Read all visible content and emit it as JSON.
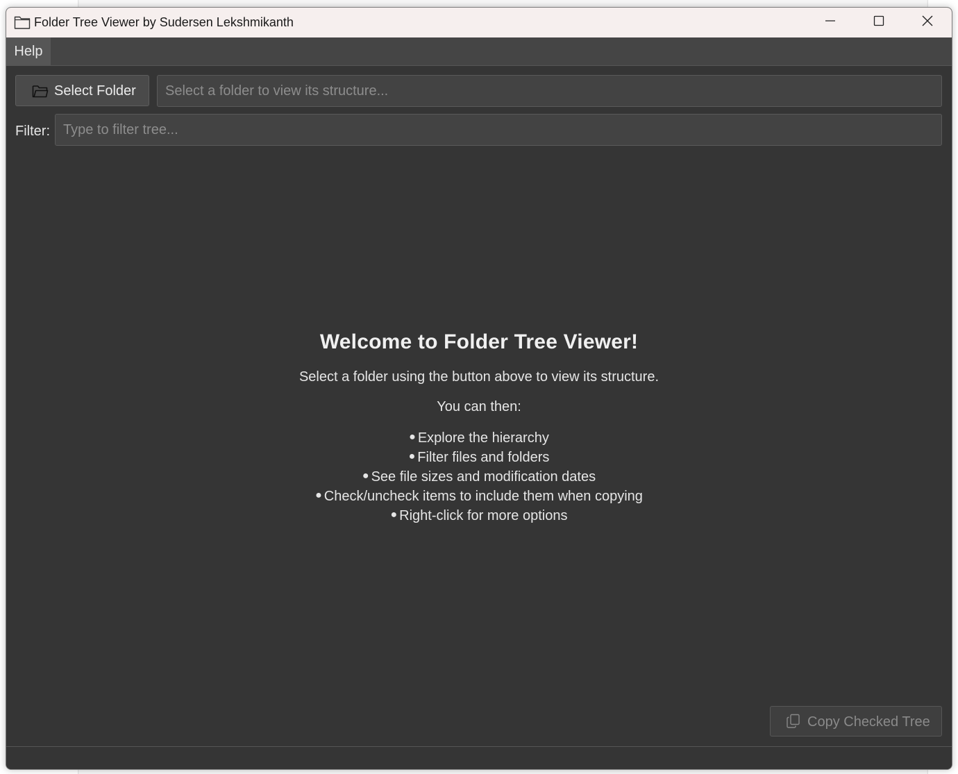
{
  "window": {
    "title": "Folder Tree Viewer by Sudersen Lekshmikanth",
    "icon": "folder-icon"
  },
  "menubar": {
    "items": [
      {
        "label": "Help"
      }
    ]
  },
  "toolbar": {
    "select_folder_label": "Select Folder",
    "select_folder_icon": "folder-open-icon",
    "path_placeholder": "Select a folder to view its structure...",
    "path_value": ""
  },
  "filter": {
    "label": "Filter:",
    "placeholder": "Type to filter tree...",
    "value": ""
  },
  "welcome": {
    "heading": "Welcome to Folder Tree Viewer!",
    "intro": "Select a folder using the button above to view its structure.",
    "then": "You can then:",
    "bullets": [
      "Explore the hierarchy",
      "Filter files and folders",
      "See file sizes and modification dates",
      "Check/uncheck items to include them when copying",
      "Right-click for more options"
    ]
  },
  "footer": {
    "copy_label": "Copy Checked Tree",
    "copy_icon": "copy-icon",
    "copy_enabled": false
  },
  "colors": {
    "window_bg": "#353535",
    "titlebar_bg": "#f6efee",
    "menubar_bg": "#454545",
    "input_bg": "#434343",
    "text": "#e6e6e6",
    "placeholder": "#8d8d8d"
  }
}
